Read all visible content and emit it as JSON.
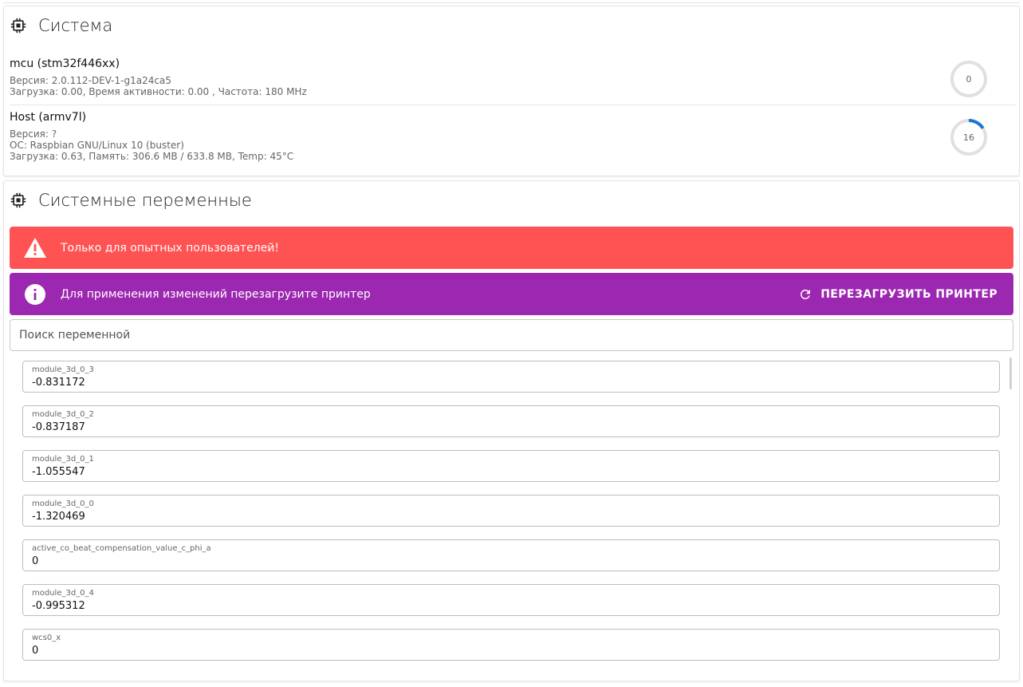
{
  "system_card": {
    "title": "Система",
    "icon": "chip-icon",
    "mcu": {
      "name": "mcu  (stm32f446xx)",
      "version": "Версия: 2.0.112-DEV-1-g1a24ca5",
      "load": "Загрузка: 0.00, Время активности: 0.00 , Частота: 180 MHz",
      "gauge_value": "0",
      "gauge_fraction": 0
    },
    "host": {
      "name": "Host  (armv7l)",
      "version": "Версия: ?",
      "os": "ОС: Raspbian GNU/Linux 10 (buster)",
      "load": "Загрузка: 0.63, Память: 306.6 MB / 633.8 MB, Temp: 45°C",
      "gauge_value": "16",
      "gauge_fraction": 0.16
    }
  },
  "variables_card": {
    "title": "Системные переменные",
    "icon": "chip-icon",
    "warning_alert": {
      "text": "Только для опытных пользователей!",
      "icon": "warning-icon",
      "color": "#ff5252"
    },
    "info_alert": {
      "text": "Для применения изменений перезагрузите принтер",
      "icon": "info-icon",
      "color": "#9c27b0",
      "button_label": "ПЕРЕЗАГРУЗИТЬ ПРИНТЕР",
      "button_icon": "refresh-icon"
    },
    "search": {
      "placeholder": "Поиск переменной",
      "value": ""
    },
    "variables": [
      {
        "label": "module_3d_0_3",
        "value": "-0.831172"
      },
      {
        "label": "module_3d_0_2",
        "value": "-0.837187"
      },
      {
        "label": "module_3d_0_1",
        "value": "-1.055547"
      },
      {
        "label": "module_3d_0_0",
        "value": "-1.320469"
      },
      {
        "label": "active_co_beat_compensation_value_c_phi_a",
        "value": "0"
      },
      {
        "label": "module_3d_0_4",
        "value": "-0.995312"
      },
      {
        "label": "wcs0_x",
        "value": "0"
      }
    ]
  },
  "colors": {
    "gauge_track": "#e0e0e0",
    "gauge_progress": "#1976d2"
  }
}
